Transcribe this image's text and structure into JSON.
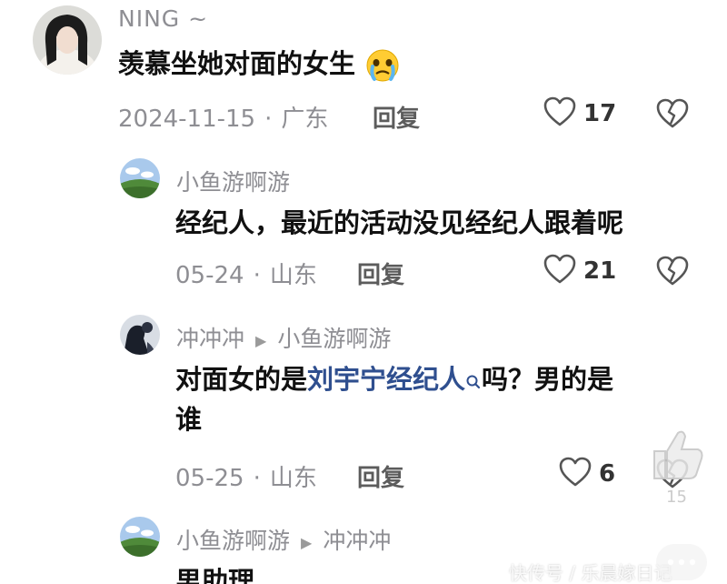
{
  "comments": [
    {
      "username": "NING ~",
      "text": "羡慕坐她对面的女生",
      "emoji": "crying-face-emoji",
      "date": "2024-11-15",
      "location": "广东",
      "reply_label": "回复",
      "likes": "17"
    },
    {
      "username": "小鱼游啊游",
      "text": "经纪人，最近的活动没见经纪人跟着呢",
      "date": "05-24",
      "location": "山东",
      "reply_label": "回复",
      "likes": "21"
    },
    {
      "username": "冲冲冲",
      "reply_to": "小鱼游啊游",
      "text_before": "对面女的是",
      "link_text": "刘宇宁经纪人",
      "text_after": "吗？男的是",
      "text_line2": "谁",
      "date": "05-25",
      "location": "山东",
      "reply_label": "回复",
      "likes": "6"
    },
    {
      "username": "小鱼游啊游",
      "reply_to": "冲冲冲",
      "text": "男助理"
    }
  ],
  "meta_separator": "·",
  "side_like_count": "15",
  "watermark": "快传号 / 乐晨嫁日记",
  "colors": {
    "link": "#2f4f8f",
    "meta": "#8e8e93",
    "text": "#111111"
  }
}
